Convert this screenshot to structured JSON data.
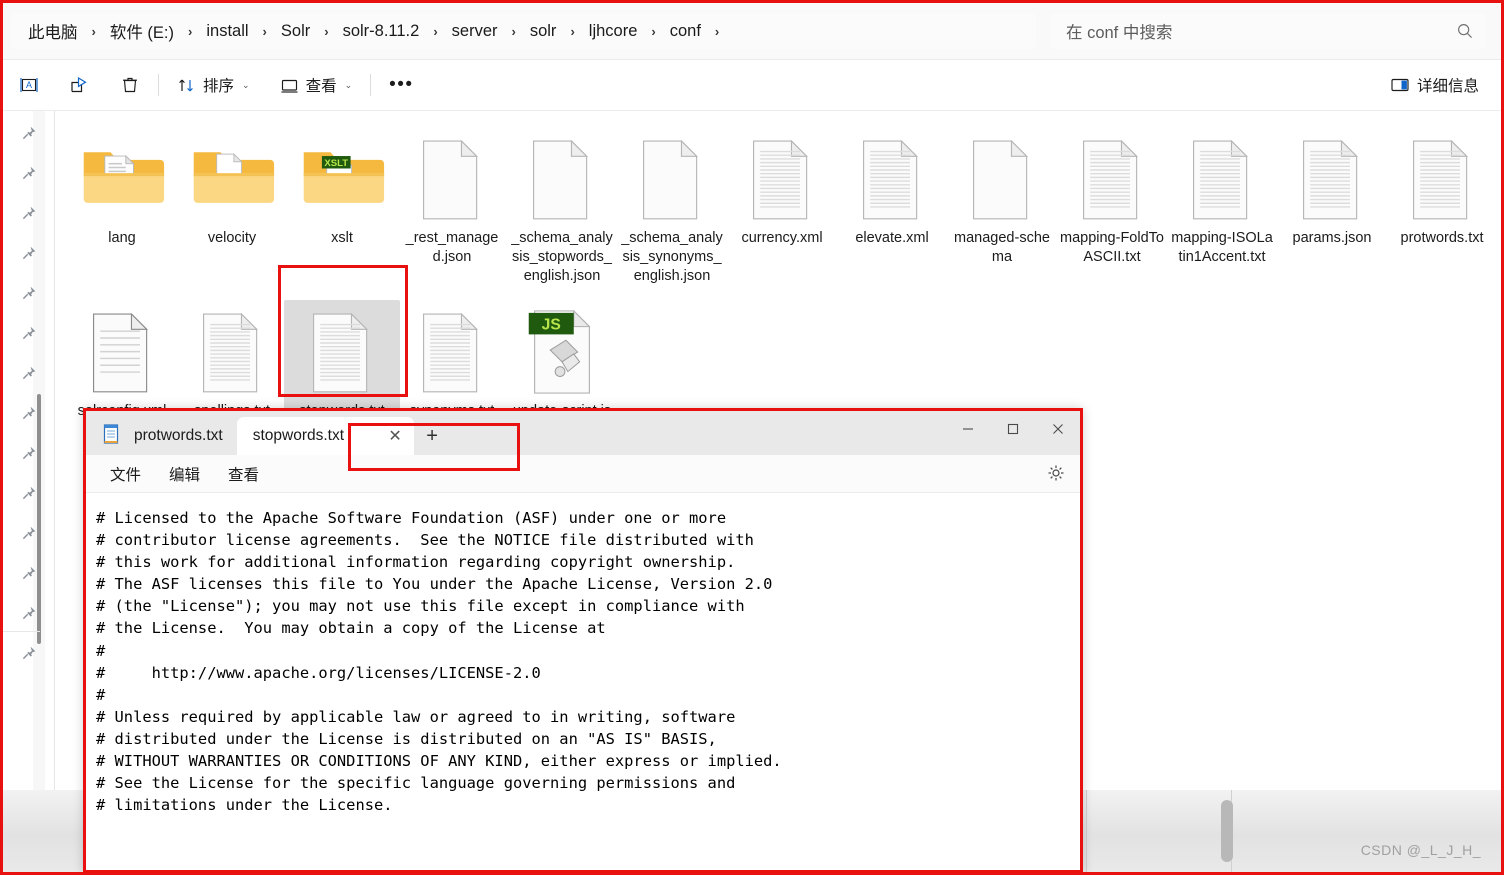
{
  "explorer": {
    "breadcrumb": {
      "items": [
        "此电脑",
        "软件 (E:)",
        "install",
        "Solr",
        "solr-8.11.2",
        "server",
        "solr",
        "ljhcore",
        "conf"
      ],
      "separator": "›"
    },
    "search": {
      "placeholder": "在 conf 中搜索",
      "value": ""
    },
    "toolbar": {
      "rename_icon": "rename-icon",
      "share_icon": "share-icon",
      "delete_icon": "delete-icon",
      "sort_label": "排序",
      "view_label": "查看",
      "more_label": "···",
      "details_label": "详细信息",
      "chevron": "⌄"
    },
    "items": [
      {
        "name": "lang",
        "type": "folder-docs"
      },
      {
        "name": "velocity",
        "type": "folder-doc"
      },
      {
        "name": "xslt",
        "type": "folder-xslt",
        "badge": "XSLT"
      },
      {
        "name": "_rest_managed.json",
        "type": "file-blank"
      },
      {
        "name": "_schema_analysis_stopwords_english.json",
        "type": "file-blank"
      },
      {
        "name": "_schema_analysis_synonyms_english.json",
        "type": "file-blank"
      },
      {
        "name": "currency.xml",
        "type": "file-lines"
      },
      {
        "name": "elevate.xml",
        "type": "file-lines"
      },
      {
        "name": "managed-schema",
        "type": "file-blank"
      },
      {
        "name": "mapping-FoldToASCII.txt",
        "type": "file-lines"
      },
      {
        "name": "mapping-ISOLatin1Accent.txt",
        "type": "file-lines"
      },
      {
        "name": "params.json",
        "type": "file-lines"
      },
      {
        "name": "protwords.txt",
        "type": "file-lines"
      },
      {
        "name": "solrconfig.xml",
        "type": "file-lines-dark"
      },
      {
        "name": "spellings.txt",
        "type": "file-lines"
      },
      {
        "name": "stopwords.txt",
        "type": "file-lines",
        "selected": true
      },
      {
        "name": "synonyms.txt",
        "type": "file-lines"
      },
      {
        "name": "update-script.js",
        "type": "file-js",
        "badge": "JS"
      }
    ],
    "status": {
      "list_view_icon": "list-view-icon",
      "details_pane_icon": "details-pane-icon"
    }
  },
  "notepad": {
    "app_icon": "notepad-icon",
    "tabs": [
      {
        "label": "protwords.txt",
        "active": false
      },
      {
        "label": "stopwords.txt",
        "active": true,
        "close": "✕"
      }
    ],
    "new_tab": "+",
    "window_controls": {
      "minimize": "—",
      "maximize": "□",
      "close": "✕"
    },
    "menu": [
      "文件",
      "编辑",
      "查看"
    ],
    "settings_icon": "gear-icon",
    "content": "# Licensed to the Apache Software Foundation (ASF) under one or more\n# contributor license agreements.  See the NOTICE file distributed with\n# this work for additional information regarding copyright ownership.\n# The ASF licenses this file to You under the Apache License, Version 2.0\n# (the \"License\"); you may not use this file except in compliance with\n# the License.  You may obtain a copy of the License at\n#\n#     http://www.apache.org/licenses/LICENSE-2.0\n#\n# Unless required by applicable law or agreed to in writing, software\n# distributed under the License is distributed on an \"AS IS\" BASIS,\n# WITHOUT WARRANTIES OR CONDITIONS OF ANY KIND, either express or implied.\n# See the License for the specific language governing permissions and\n# limitations under the License."
  },
  "watermark": "CSDN @_L_J_H_",
  "colors": {
    "annotation": "#e8110f",
    "folder": "#f2b134",
    "selection": "#dcdcdc",
    "accent": "#4aa8e0"
  }
}
